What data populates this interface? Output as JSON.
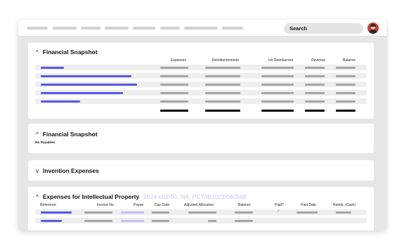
{
  "topbar": {
    "search_label": "Search",
    "nav_items": [
      "",
      "",
      "",
      "",
      "",
      "",
      "",
      ""
    ]
  },
  "sections": {
    "snapshot_1": {
      "title": "Financial Snapshot",
      "chevron": "^",
      "columns": [
        "Expenses",
        "Reimbursements",
        "Un-Reimbursed",
        "Revenue",
        "Balance"
      ]
    },
    "snapshot_2": {
      "title": "Financial Snapshot",
      "chevron": "^",
      "empty_text": "No Payables"
    },
    "invention": {
      "title": "Invention Expenses",
      "chevron": "v"
    },
    "ip_expenses": {
      "title": "Expenses for Intellectual Property",
      "subtitle": "2024-002-01, NA, PCT/IB2022/060568",
      "chevron": "^",
      "columns": [
        "Reference",
        "Invoice No.",
        "Payee",
        "Due Date",
        "Adjusted Allocation",
        "Balance",
        "Paid?",
        "Paid Date",
        "Reimb. (Cash)"
      ],
      "check_mark": "✓"
    }
  },
  "colors": {
    "accent": "#5858e0",
    "accent_light": "#c5c1f0",
    "placeholder": "#a5a5a5",
    "background": "#e6e6e6"
  }
}
